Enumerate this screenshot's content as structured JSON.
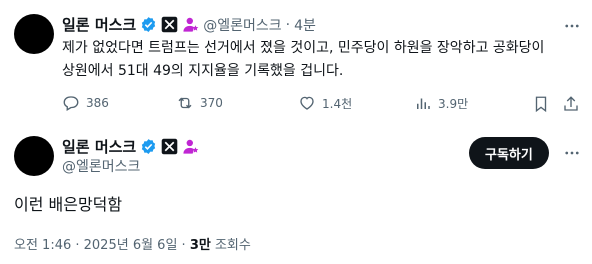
{
  "reply_tweet": {
    "display_name": "일론 머스크",
    "handle": "@엘론머스크",
    "separator": "·",
    "time": "4분",
    "text_line1": "제가 없었다면 트럼프는 선거에서 졌을 것이고, 민주당이 하원을 장악하고 공화당이",
    "text_line2": "상원에서 51대 49의 지지율을 기록했을 겁니다.",
    "actions": {
      "replies": "386",
      "reposts": "370",
      "likes": "1.4천",
      "views": "3.9만"
    }
  },
  "main_tweet": {
    "display_name": "일론 머스크",
    "handle": "@엘론머스크",
    "follow_label": "구독하기",
    "text": "이런 배은망덕함",
    "timestamp": "오전 1:46 · 2025년 6월 6일 · ",
    "views_count": "3만",
    "views_label": " 조회수"
  },
  "colors": {
    "verified": "#1d9bf0",
    "affiliate_badge": "#c026d3",
    "muted": "#536471"
  }
}
